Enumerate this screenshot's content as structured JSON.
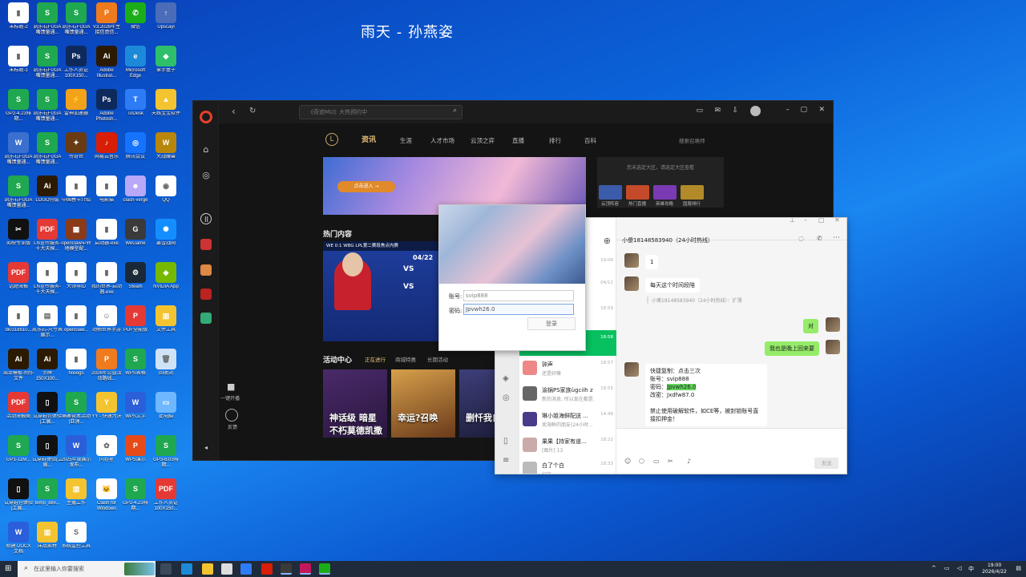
{
  "song_title": "雨天 - 孙燕姿",
  "desktop_icons": [
    {
      "label": "未标题-2",
      "color": "#ffffff",
      "glyph": "▮",
      "icon": "file-icon"
    },
    {
      "label": "凯乐石FUGA嘴馈量通...",
      "color": "#1fa84f",
      "glyph": "S",
      "icon": "spreadsheet-icon"
    },
    {
      "label": "凯乐石FUGA嘴馈量通...",
      "color": "#1fa84f",
      "glyph": "S",
      "icon": "spreadsheet-icon"
    },
    {
      "label": "V3.2026年生接信意信...",
      "color": "#f07a1e",
      "glyph": "P",
      "icon": "slides-icon"
    },
    {
      "label": "微信",
      "color": "#1aad19",
      "glyph": "✆",
      "icon": "wechat-icon"
    },
    {
      "label": "Upscayl",
      "color": "#4b6cb7",
      "glyph": "↑",
      "icon": "upscayl-icon"
    },
    {
      "label": "未标题-1",
      "color": "#ffffff",
      "glyph": "▮",
      "icon": "file-icon"
    },
    {
      "label": "凯乐石FUGA嘴馈量通...",
      "color": "#1fa84f",
      "glyph": "S",
      "icon": "spreadsheet-icon"
    },
    {
      "label": "工作人员证100X150...",
      "color": "#0e2a5c",
      "glyph": "Ps",
      "icon": "photoshop-icon"
    },
    {
      "label": "Adobe Illustrat...",
      "color": "#2b1a00",
      "glyph": "Ai",
      "icon": "illustrator-icon"
    },
    {
      "label": "Microsoft Edge",
      "color": "#1d8ad9",
      "glyph": "e",
      "icon": "edge-icon"
    },
    {
      "label": "掌手盒子",
      "color": "#2ebf6a",
      "glyph": "◆",
      "icon": "box-icon"
    },
    {
      "label": "GP2-4.23排期...",
      "color": "#1fa84f",
      "glyph": "S",
      "icon": "spreadsheet-icon"
    },
    {
      "label": "凯乐石FUGA嘴馈量通...",
      "color": "#1fa84f",
      "glyph": "S",
      "icon": "spreadsheet-icon"
    },
    {
      "label": "雷神加速器",
      "color": "#f3a21a",
      "glyph": "⚡",
      "icon": "accelerator-icon"
    },
    {
      "label": "Adobe Photosh...",
      "color": "#0e2a5c",
      "glyph": "Ps",
      "icon": "photoshop-icon"
    },
    {
      "label": "ToDesk",
      "color": "#2d7cf6",
      "glyph": "T",
      "icon": "todesk-icon"
    },
    {
      "label": "天线宝宝软件",
      "color": "#f4c430",
      "glyph": "▲",
      "icon": "app-icon"
    },
    {
      "label": "凯乐石FUGA嘴馈量通...",
      "color": "#3b6fd0",
      "glyph": "W",
      "icon": "document-icon"
    },
    {
      "label": "凯乐石FUGA嘴馈量通...",
      "color": "#1fa84f",
      "glyph": "S",
      "icon": "spreadsheet-icon"
    },
    {
      "label": "传奇世",
      "color": "#6a3b12",
      "glyph": "✦",
      "icon": "game-icon"
    },
    {
      "label": "网易云音乐",
      "color": "#d81e06",
      "glyph": "♪",
      "icon": "music-icon"
    },
    {
      "label": "腾讯会议",
      "color": "#1673ff",
      "glyph": "◎",
      "icon": "meeting-icon"
    },
    {
      "label": "大战魔兽",
      "color": "#b8860b",
      "glyph": "W",
      "icon": "warcraft-icon"
    },
    {
      "label": "凯乐石FUGA嘴馈量通...",
      "color": "#1fa84f",
      "glyph": "S",
      "icon": "spreadsheet-icon"
    },
    {
      "label": "LOGO分层",
      "color": "#2b1a00",
      "glyph": "Ai",
      "icon": "illustrator-icon"
    },
    {
      "label": "中国春节介绍",
      "color": "#ffffff",
      "glyph": "▮",
      "icon": "file-icon"
    },
    {
      "label": "电影猫",
      "color": "#ffffff",
      "glyph": "▮",
      "icon": "file-icon"
    },
    {
      "label": "clash-verge",
      "color": "#b9a7f7",
      "glyph": "☻",
      "icon": "clash-icon"
    },
    {
      "label": "QQ",
      "color": "#ffffff",
      "glyph": "◉",
      "icon": "qq-icon"
    },
    {
      "label": "剪映专业版",
      "color": "#111111",
      "glyph": "✂",
      "icon": "capcut-icon"
    },
    {
      "label": "LN宣传服务-十大天候...",
      "color": "#e53935",
      "glyph": "PDF",
      "icon": "pdf-icon"
    },
    {
      "label": "openclaw中转地模型配...",
      "color": "#8b3a1a",
      "glyph": "▦",
      "icon": "archive-icon"
    },
    {
      "label": "启动器-exe",
      "color": "#ffffff",
      "glyph": "▮",
      "icon": "file-icon"
    },
    {
      "label": "WeGame",
      "color": "#3a3a3a",
      "glyph": "G",
      "icon": "wegame-icon"
    },
    {
      "label": "暴雪战网",
      "color": "#148eff",
      "glyph": "✺",
      "icon": "battlenet-icon"
    },
    {
      "label": "话题海报",
      "color": "#e53935",
      "glyph": "PDF",
      "icon": "pdf-icon"
    },
    {
      "label": "LN宣传服务-十大天候...",
      "color": "#ffffff",
      "glyph": "▮",
      "icon": "file-icon"
    },
    {
      "label": "大领导ID",
      "color": "#ffffff",
      "glyph": "▮",
      "icon": "file-icon"
    },
    {
      "label": "我的世界-启动器.exe",
      "color": "#ffffff",
      "glyph": "▮",
      "icon": "file-icon"
    },
    {
      "label": "Steam",
      "color": "#1b2838",
      "glyph": "⚙",
      "icon": "steam-icon"
    },
    {
      "label": "NVIDIA App",
      "color": "#76b900",
      "glyph": "◈",
      "icon": "nvidia-icon"
    },
    {
      "label": "di0318810...",
      "color": "#ffffff",
      "glyph": "▮",
      "icon": "file-icon"
    },
    {
      "label": "凯乐石-尺寸表展示...",
      "color": "#ffffff",
      "glyph": "▤",
      "icon": "image-icon"
    },
    {
      "label": "openclaw...",
      "color": "#ffffff",
      "glyph": "▮",
      "icon": "file-icon"
    },
    {
      "label": "动物世界手游",
      "color": "#ffffff",
      "glyph": "☺",
      "icon": "game-icon"
    },
    {
      "label": "PDF全能版",
      "color": "#e53935",
      "glyph": "P",
      "icon": "pdf-app-icon"
    },
    {
      "label": "文件工具",
      "color": "#f4c430",
      "glyph": "▥",
      "icon": "folder-icon"
    },
    {
      "label": "出单模板-制作文件",
      "color": "#2b1a00",
      "glyph": "Ai",
      "icon": "illustrator-icon"
    },
    {
      "label": "手牌150X100...",
      "color": "#2b1a00",
      "glyph": "Ai",
      "icon": "illustrator-icon"
    },
    {
      "label": "holiogs",
      "color": "#ffffff",
      "glyph": "▮",
      "icon": "file-icon"
    },
    {
      "label": "2026年公益活动路线...",
      "color": "#f07a1e",
      "glyph": "P",
      "icon": "slides-icon"
    },
    {
      "label": "WPS表格",
      "color": "#1fa84f",
      "glyph": "S",
      "icon": "wps-sheet-icon"
    },
    {
      "label": "回收站",
      "color": "#cfe3f7",
      "glyph": "🗑",
      "icon": "recycle-bin-icon"
    },
    {
      "label": "活动海报图",
      "color": "#e53935",
      "glyph": "PDF",
      "icon": "pdf-icon"
    },
    {
      "label": "试穿鞋包体验(工展...",
      "color": "#111111",
      "glyph": "▯",
      "icon": "file-icon"
    },
    {
      "label": "埔寨营本活动(亚洲...",
      "color": "#1fa84f",
      "glyph": "S",
      "icon": "spreadsheet-icon"
    },
    {
      "label": "YY - 快速为沃",
      "color": "#f4c430",
      "glyph": "Y",
      "icon": "yy-icon"
    },
    {
      "label": "WPS文字",
      "color": "#2b5fd9",
      "glyph": "W",
      "icon": "wps-writer-icon"
    },
    {
      "label": "此电脑",
      "color": "#6fb7ff",
      "glyph": "▭",
      "icon": "computer-icon"
    },
    {
      "label": "GP1-11M...",
      "color": "#1fa84f",
      "glyph": "S",
      "icon": "spreadsheet-icon"
    },
    {
      "label": "试穿鞋体验(工展...",
      "color": "#111111",
      "glyph": "▯",
      "icon": "file-icon"
    },
    {
      "label": "2025年度展示发布...",
      "color": "#2b5fd9",
      "glyph": "W",
      "icon": "document-icon"
    },
    {
      "label": "问卷星",
      "color": "#ffffff",
      "glyph": "✿",
      "icon": "survey-icon"
    },
    {
      "label": "WPS演示",
      "color": "#e64a19",
      "glyph": "P",
      "icon": "wps-slides-icon"
    },
    {
      "label": "GP3-6.03排期...",
      "color": "#1fa84f",
      "glyph": "S",
      "icon": "spreadsheet-icon"
    },
    {
      "label": "试穿鞋包体验(工展...",
      "color": "#111111",
      "glyph": "▯",
      "icon": "file-icon"
    },
    {
      "label": "temp_dev...",
      "color": "#1fa84f",
      "glyph": "S",
      "icon": "spreadsheet-icon"
    },
    {
      "label": "主播工作",
      "color": "#f4c430",
      "glyph": "▥",
      "icon": "folder-icon"
    },
    {
      "label": "Clash for Windows",
      "color": "#ffffff",
      "glyph": "🐱",
      "icon": "clash-icon"
    },
    {
      "label": "GP2-4.23排期...",
      "color": "#1fa84f",
      "glyph": "S",
      "icon": "spreadsheet-icon"
    },
    {
      "label": "工作人员证100X150...",
      "color": "#e53935",
      "glyph": "PDF",
      "icon": "pdf-icon"
    },
    {
      "label": "新建 DOCX 文档",
      "color": "#2b5fd9",
      "glyph": "W",
      "icon": "document-icon"
    },
    {
      "label": "床品素材",
      "color": "#f4c430",
      "glyph": "▥",
      "icon": "folder-icon"
    },
    {
      "label": "系统监控工具",
      "color": "#ffffff",
      "glyph": "S",
      "icon": "app-icon"
    }
  ],
  "wegame": {
    "search_placeholder": "《奇迹MU》大热预约中",
    "nav": [
      "资讯",
      "生涯",
      "人才市场",
      "云顶之弈",
      "直播",
      "排行",
      "百科"
    ],
    "search_right": "搜索召唤师",
    "banner_button": "点击进入 →",
    "hot_title": "热门内容",
    "hot_caption": "WE 0:1 WBG LPL第二赛段焦点内赛",
    "hot_date": "04/22",
    "activity_title": "活动中心",
    "activity_tabs": [
      "正在进行",
      "商城特惠",
      "长期活动"
    ],
    "activity_cards": [
      {
        "text": "神话级 暗星 不朽莫德凯撒",
        "bg": "linear-gradient(160deg,#4a2a6a,#2a163e)"
      },
      {
        "text": "幸运?召唤",
        "bg": "linear-gradient(160deg,#d7a04b,#6a3a1a)"
      },
      {
        "text": "删忏我自负",
        "bg": "linear-gradient(160deg,#3d3f7a,#1a1a33)"
      }
    ],
    "right_panel_text": "您未选定大区，请选定大区查看",
    "right_tiles": [
      "云顶阵容",
      "热门直播",
      "英雄攻略",
      "国服排行"
    ],
    "side_live": "一键开播",
    "side_feedback": "反馈"
  },
  "login_popup": {
    "account_label": "账号:",
    "account_value": "svip888",
    "password_label": "密码:",
    "password_value": "Jpvwh26.0",
    "login_button": "登录"
  },
  "wechat": {
    "chat_title": "小傻18148583940（24小时热线）",
    "contacts": [
      {
        "name": "",
        "preview": "",
        "time": "19:06",
        "avatar": "#999"
      },
      {
        "name": "",
        "preview": "",
        "time": "04/11",
        "avatar": "#aaa"
      },
      {
        "name": "",
        "preview": "",
        "time": "18:59",
        "avatar": "#aaa"
      },
      {
        "name": "",
        "preview": "",
        "time": "18:58",
        "avatar": "#6b5a48"
      },
      {
        "name": "钟声",
        "preview": "还是好嘛",
        "time": "18:57",
        "avatar": "#e88"
      },
      {
        "name": "渝锅PS家族ùgciih z",
        "preview": "新的消息: 所以现在都是...",
        "time": "18:55",
        "avatar": "#666"
      },
      {
        "name": "琳小姐海鲜配送 ...",
        "preview": "卖海鲜的朋友(24小时...",
        "time": "14:49",
        "avatar": "#4a3a8a"
      },
      {
        "name": "果果【持家有道...",
        "preview": "[图片] 13",
        "time": "18:21",
        "avatar": "#caa"
      },
      {
        "name": "白了个白",
        "preview": "好的",
        "time": "18:33",
        "avatar": "#bbb"
      }
    ],
    "messages": [
      {
        "from": "them",
        "text": "1"
      },
      {
        "from": "them",
        "text": "每天这个时间段陪"
      },
      {
        "from": "quote",
        "text": "小傻18148583940（24小时热线）：扩漂"
      },
      {
        "from": "me",
        "text": "对"
      },
      {
        "from": "me",
        "text": "我也是晚上回来要"
      },
      {
        "from": "them",
        "lines": [
          "快捷复制：点击三次",
          "账号：svip888",
          "密码：Jpvwh26.0",
          "改密：Jxdfw87.0",
          "",
          "禁止使用破解软件，如CE等，被封锁账号直接扣押金！"
        ]
      }
    ],
    "send_label": "发送"
  },
  "taskbar": {
    "search_placeholder": "在这里输入你要搜索",
    "time": "19:00",
    "date": "2026/4/22",
    "ime": "中"
  }
}
